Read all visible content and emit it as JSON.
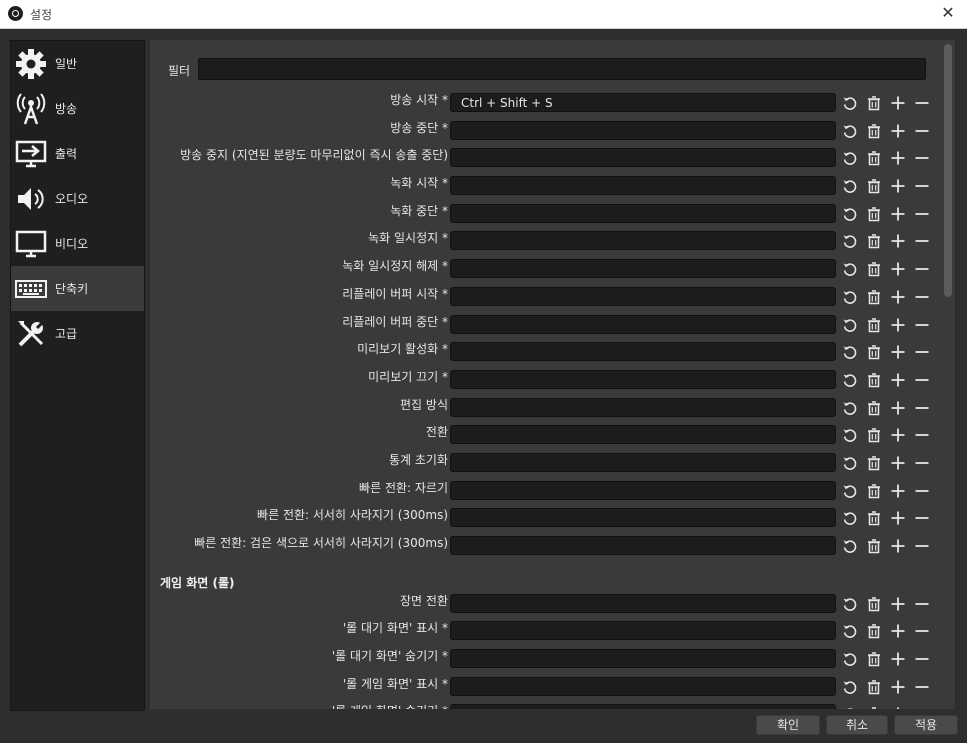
{
  "window": {
    "title": "설정"
  },
  "sidebar": {
    "items": [
      {
        "label": "일반",
        "icon": "gear-icon"
      },
      {
        "label": "방송",
        "icon": "broadcast-antenna-icon"
      },
      {
        "label": "출력",
        "icon": "output-monitor-icon"
      },
      {
        "label": "오디오",
        "icon": "speaker-icon"
      },
      {
        "label": "비디오",
        "icon": "monitor-icon"
      },
      {
        "label": "단축키",
        "icon": "keyboard-icon",
        "active": true
      },
      {
        "label": "고급",
        "icon": "tools-icon"
      }
    ]
  },
  "filter": {
    "label": "필터",
    "value": ""
  },
  "hotkeys": [
    {
      "label": "방송 시작 *",
      "value": "Ctrl + Shift + S"
    },
    {
      "label": "방송 중단 *",
      "value": ""
    },
    {
      "label": "방송 중지 (지연된 분량도 마무리없이 즉시 송출 중단)",
      "value": ""
    },
    {
      "label": "녹화 시작 *",
      "value": ""
    },
    {
      "label": "녹화 중단 *",
      "value": ""
    },
    {
      "label": "녹화 일시정지 *",
      "value": ""
    },
    {
      "label": "녹화 일시정지 해제 *",
      "value": ""
    },
    {
      "label": "리플레이 버퍼 시작 *",
      "value": ""
    },
    {
      "label": "리플레이 버퍼 중단 *",
      "value": ""
    },
    {
      "label": "미리보기 활성화 *",
      "value": ""
    },
    {
      "label": "미리보기 끄기 *",
      "value": ""
    },
    {
      "label": "편집 방식",
      "value": ""
    },
    {
      "label": "전환",
      "value": ""
    },
    {
      "label": "통계 초기화",
      "value": ""
    },
    {
      "label": "빠른 전환: 자르기",
      "value": ""
    },
    {
      "label": "빠른 전환: 서서히 사라지기 (300ms)",
      "value": ""
    },
    {
      "label": "빠른 전환: 검은 색으로 서서히 사라지기 (300ms)",
      "value": ""
    }
  ],
  "section_game": {
    "title": "게임 화면 (롤)",
    "hotkeys": [
      {
        "label": "장면 전환",
        "value": ""
      },
      {
        "label": "'롤 대기 화면' 표시 *",
        "value": ""
      },
      {
        "label": "'롤 대기 화면' 숨기기 *",
        "value": ""
      },
      {
        "label": "'롤 게임 화면' 표시 *",
        "value": ""
      },
      {
        "label": "'롤 게임 화면' 숨기기 *",
        "value": ""
      }
    ]
  },
  "row_buttons": {
    "revert": "revert-icon",
    "delete": "trash-icon",
    "add": "plus-icon",
    "remove": "minus-icon"
  },
  "footer": {
    "ok": "확인",
    "cancel": "취소",
    "apply": "적용"
  },
  "colors": {
    "background": "#2e2e2e",
    "panel": "#3a3a3a",
    "field": "#1c1c1c",
    "sidebar_active": "#3b3b3b"
  }
}
